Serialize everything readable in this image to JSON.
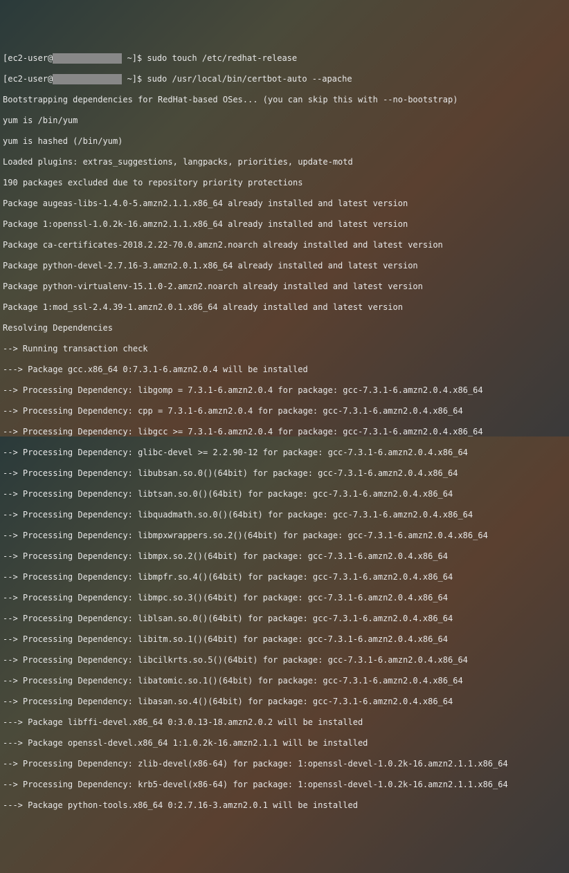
{
  "prompt1": {
    "user": "[ec2-user@",
    "path": " ~]$ ",
    "cmd": "sudo touch /etc/redhat-release"
  },
  "prompt2": {
    "user": "[ec2-user@",
    "path": " ~]$ ",
    "cmd": "sudo /usr/local/bin/certbot-auto --apache"
  },
  "lines": {
    "l0": "Bootstrapping dependencies for RedHat-based OSes... (you can skip this with --no-bootstrap)",
    "l1": "yum is /bin/yum",
    "l2": "yum is hashed (/bin/yum)",
    "l3": "Loaded plugins: extras_suggestions, langpacks, priorities, update-motd",
    "l4": "190 packages excluded due to repository priority protections",
    "l5": "Package augeas-libs-1.4.0-5.amzn2.1.1.x86_64 already installed and latest version",
    "l6": "Package 1:openssl-1.0.2k-16.amzn2.1.1.x86_64 already installed and latest version",
    "l7": "Package ca-certificates-2018.2.22-70.0.amzn2.noarch already installed and latest version",
    "l8": "Package python-devel-2.7.16-3.amzn2.0.1.x86_64 already installed and latest version",
    "l9": "Package python-virtualenv-15.1.0-2.amzn2.noarch already installed and latest version",
    "l10": "Package 1:mod_ssl-2.4.39-1.amzn2.0.1.x86_64 already installed and latest version",
    "l11": "Resolving Dependencies",
    "l12": "--> Running transaction check",
    "l13": "---> Package gcc.x86_64 0:7.3.1-6.amzn2.0.4 will be installed",
    "l14": "--> Processing Dependency: libgomp = 7.3.1-6.amzn2.0.4 for package: gcc-7.3.1-6.amzn2.0.4.x86_64",
    "l15": "--> Processing Dependency: cpp = 7.3.1-6.amzn2.0.4 for package: gcc-7.3.1-6.amzn2.0.4.x86_64",
    "l16": "--> Processing Dependency: libgcc >= 7.3.1-6.amzn2.0.4 for package: gcc-7.3.1-6.amzn2.0.4.x86_64",
    "l17": "--> Processing Dependency: glibc-devel >= 2.2.90-12 for package: gcc-7.3.1-6.amzn2.0.4.x86_64",
    "l18": "--> Processing Dependency: libubsan.so.0()(64bit) for package: gcc-7.3.1-6.amzn2.0.4.x86_64",
    "l19": "--> Processing Dependency: libtsan.so.0()(64bit) for package: gcc-7.3.1-6.amzn2.0.4.x86_64",
    "l20": "--> Processing Dependency: libquadmath.so.0()(64bit) for package: gcc-7.3.1-6.amzn2.0.4.x86_64",
    "l21": "--> Processing Dependency: libmpxwrappers.so.2()(64bit) for package: gcc-7.3.1-6.amzn2.0.4.x86_64",
    "l22": "--> Processing Dependency: libmpx.so.2()(64bit) for package: gcc-7.3.1-6.amzn2.0.4.x86_64",
    "l23": "--> Processing Dependency: libmpfr.so.4()(64bit) for package: gcc-7.3.1-6.amzn2.0.4.x86_64",
    "l24": "--> Processing Dependency: libmpc.so.3()(64bit) for package: gcc-7.3.1-6.amzn2.0.4.x86_64",
    "l25": "--> Processing Dependency: liblsan.so.0()(64bit) for package: gcc-7.3.1-6.amzn2.0.4.x86_64",
    "l26": "--> Processing Dependency: libitm.so.1()(64bit) for package: gcc-7.3.1-6.amzn2.0.4.x86_64",
    "l27": "--> Processing Dependency: libcilkrts.so.5()(64bit) for package: gcc-7.3.1-6.amzn2.0.4.x86_64",
    "l28": "--> Processing Dependency: libatomic.so.1()(64bit) for package: gcc-7.3.1-6.amzn2.0.4.x86_64",
    "l29": "--> Processing Dependency: libasan.so.4()(64bit) for package: gcc-7.3.1-6.amzn2.0.4.x86_64",
    "l30": "---> Package libffi-devel.x86_64 0:3.0.13-18.amzn2.0.2 will be installed",
    "l31": "---> Package openssl-devel.x86_64 1:1.0.2k-16.amzn2.1.1 will be installed",
    "l32": "--> Processing Dependency: zlib-devel(x86-64) for package: 1:openssl-devel-1.0.2k-16.amzn2.1.1.x86_64",
    "l33": "--> Processing Dependency: krb5-devel(x86-64) for package: 1:openssl-devel-1.0.2k-16.amzn2.1.1.x86_64",
    "l34": "---> Package python-tools.x86_64 0:2.7.16-3.amzn2.0.1 will be installed"
  }
}
